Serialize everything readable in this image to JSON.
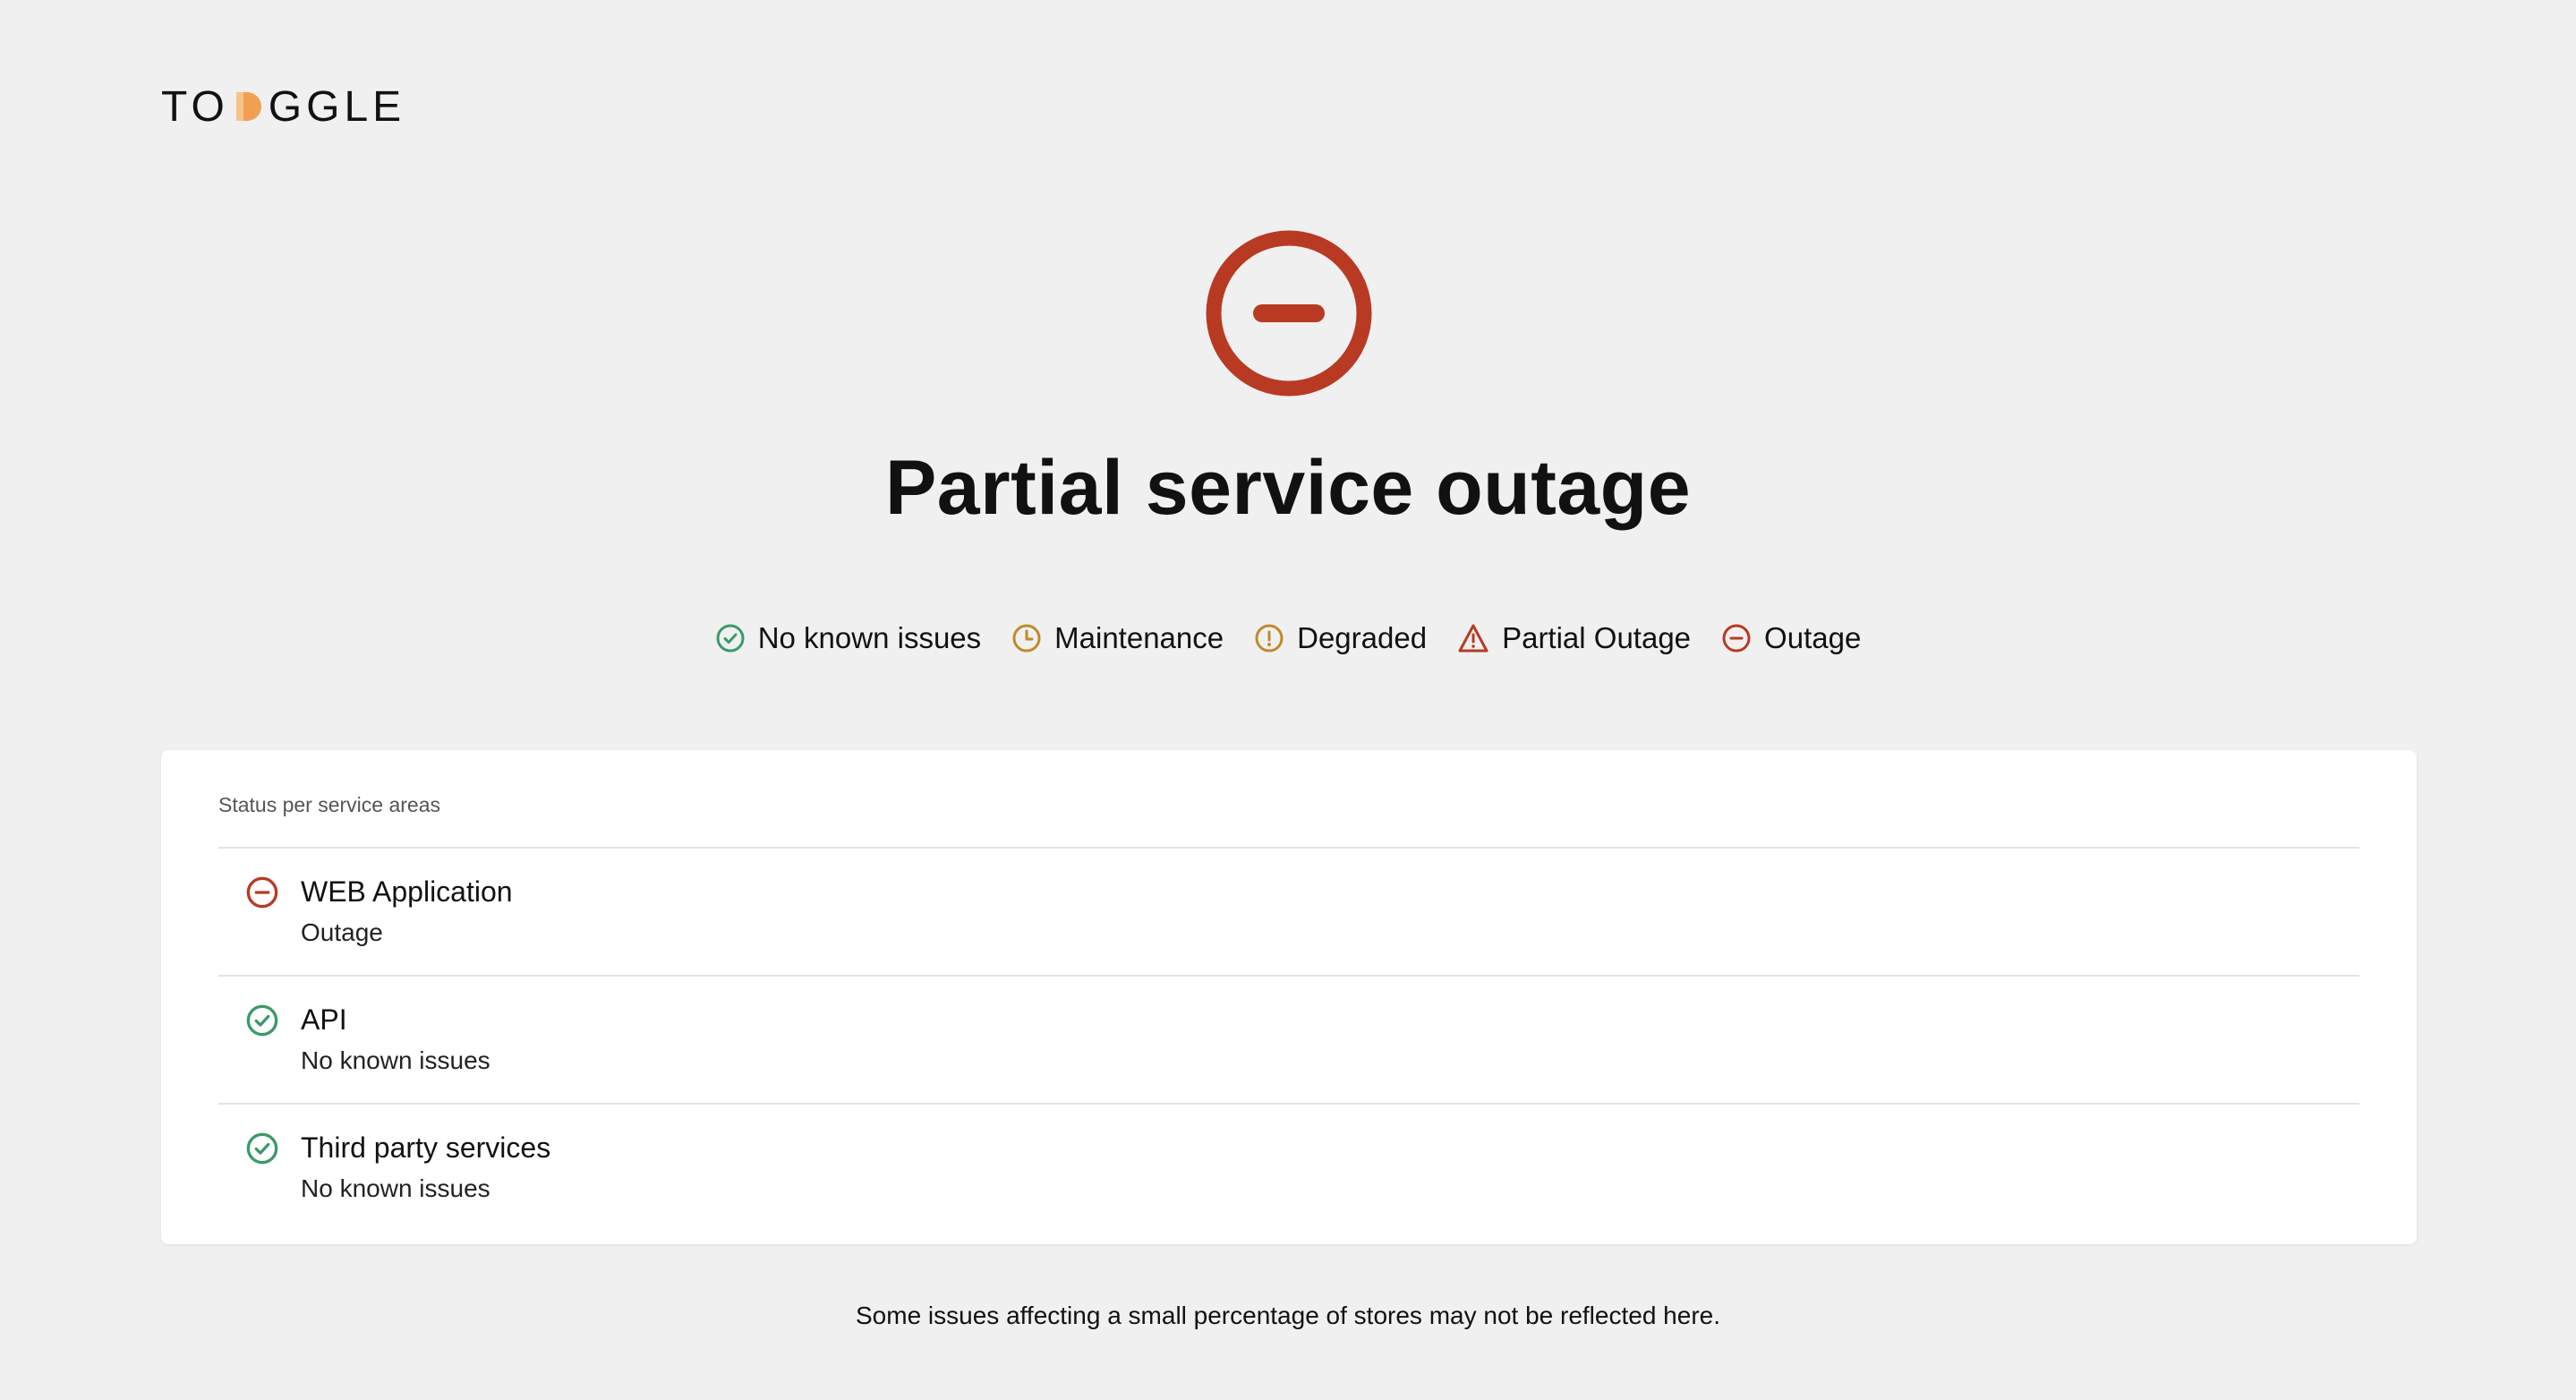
{
  "brand": {
    "logo_before": "TO",
    "logo_after": "GGLE",
    "accent_color": "#f0a050"
  },
  "overall": {
    "title": "Partial service outage",
    "icon": "outage-icon",
    "color": "#b83a23"
  },
  "legend": [
    {
      "label": "No known issues",
      "icon": "check-circle-icon",
      "color": "#3a9a6a"
    },
    {
      "label": "Maintenance",
      "icon": "clock-icon",
      "color": "#c08a2a"
    },
    {
      "label": "Degraded",
      "icon": "exclamation-circle-icon",
      "color": "#c08a2a"
    },
    {
      "label": "Partial Outage",
      "icon": "warning-triangle-icon",
      "color": "#b83a23"
    },
    {
      "label": "Outage",
      "icon": "minus-circle-icon",
      "color": "#b83a23"
    }
  ],
  "services": {
    "heading": "Status per service areas",
    "items": [
      {
        "name": "WEB Application",
        "status": "Outage",
        "icon": "minus-circle-icon",
        "color": "#b83a23"
      },
      {
        "name": "API",
        "status": "No known issues",
        "icon": "check-circle-icon",
        "color": "#3a9a6a"
      },
      {
        "name": "Third party services",
        "status": "No known issues",
        "icon": "check-circle-icon",
        "color": "#3a9a6a"
      }
    ]
  },
  "footnote": "Some issues affecting a small percentage of stores may not be reflected here."
}
